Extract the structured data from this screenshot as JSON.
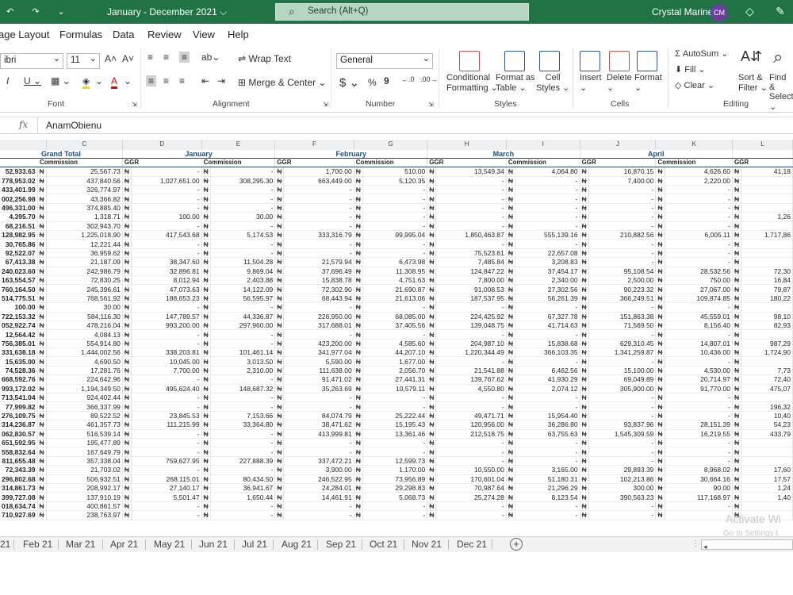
{
  "titlebar": {
    "title": "January - December 2021 ⌵",
    "search": "Search (Alt+Q)",
    "user": "Crystal Marine",
    "initials": "CM"
  },
  "tabs": [
    "age Layout",
    "Formulas",
    "Data",
    "Review",
    "View",
    "Help"
  ],
  "ribbon": {
    "font_name": "ibri",
    "font_size": "11",
    "number_format": "General",
    "wrap_text": "Wrap Text",
    "merge_center": "Merge & Center",
    "cond_format": "Conditional",
    "cond_format2": "Formatting ⌄",
    "format_table": "Format as",
    "format_table2": "Table ⌄",
    "cell_styles": "Cell",
    "cell_styles2": "Styles ⌄",
    "insert": "Insert",
    "delete": "Delete",
    "format": "Format",
    "autosum": "AutoSum ⌄",
    "fill": "Fill ⌄",
    "clear": "Clear ⌄",
    "sort_filter": "Sort &",
    "sort_filter2": "Filter ⌄",
    "find_select": "Find &",
    "find_select2": "Select ⌄",
    "groups": {
      "font": "Font",
      "alignment": "Alignment",
      "number": "Number",
      "styles": "Styles",
      "cells": "Cells",
      "editing": "Editing"
    }
  },
  "formula_bar": {
    "fx": "fx",
    "value": "AnamObienu"
  },
  "sheet": {
    "col_letters": [
      "",
      "C",
      "D",
      "E",
      "F",
      "G",
      "H",
      "I",
      "J",
      "K",
      "L"
    ],
    "header1": {
      "grand_total": "Grand Total",
      "january": "January",
      "february": "February",
      "march": "March",
      "april": "April"
    },
    "header2": {
      "commission": "Commission",
      "ggr": "GGR"
    },
    "currency": "₦",
    "rows": [
      [
        "52,933.63",
        "25,567.73",
        "-",
        "-",
        "1,700.00",
        "510.00",
        "13,549.34",
        "4,064.80",
        "16,870.15",
        "4,626.60",
        "41,18"
      ],
      [
        "778,953.02",
        "437,840.56",
        "1,027,651.00",
        "308,295.30",
        "663,449.00",
        "5,120.35",
        "-",
        "-",
        "7,400.00",
        "2,220.00",
        ""
      ],
      [
        "433,401.99",
        "326,774.97",
        "-",
        "-",
        "-",
        "-",
        "-",
        "-",
        "-",
        "-",
        ""
      ],
      [
        "002,256.98",
        "43,366.82",
        "-",
        "-",
        "-",
        "-",
        "-",
        "-",
        "-",
        "-",
        ""
      ],
      [
        "496,331.00",
        "374,885.40",
        "-",
        "-",
        "-",
        "-",
        "-",
        "-",
        "-",
        "-",
        ""
      ],
      [
        "4,395.70",
        "1,318.71",
        "100.00",
        "30.00",
        "-",
        "-",
        "-",
        "-",
        "-",
        "-",
        "1,26"
      ],
      [
        "68,216.51",
        "302,943.70",
        "-",
        "-",
        "-",
        "-",
        "-",
        "-",
        "-",
        "-",
        ""
      ],
      [
        "128,982.95",
        "1,225,018.90",
        "417,543.68",
        "5,174.53",
        "333,316.79",
        "99,995.04",
        "1,850,463.87",
        "555,139.16",
        "210,882.56",
        "6,005.11",
        "1,717,86"
      ],
      [
        "30,765.86",
        "12,221.44",
        "-",
        "-",
        "-",
        "-",
        "-",
        "-",
        "-",
        "-",
        ""
      ],
      [
        "92,522.07",
        "36,959.62",
        "-",
        "-",
        "-",
        "-",
        "75,523.61",
        "22,657.08",
        "-",
        "-",
        ""
      ],
      [
        "67,413.38",
        "21,187.09",
        "38,347.60",
        "11,504.28",
        "21,579.94",
        "6,473.98",
        "7,485.84",
        "3,208.83",
        "-",
        "-",
        ""
      ],
      [
        "240,023.60",
        "242,986.79",
        "32,896.81",
        "9,869.04",
        "37,696.49",
        "11,308.95",
        "124,847.22",
        "37,454.17",
        "95,108.54",
        "28,532.56",
        "72,30"
      ],
      [
        "163,554.57",
        "72,830.25",
        "8,012.94",
        "2,403.88",
        "15,838.78",
        "4,751.63",
        "7,800.00",
        "2,340.00",
        "2,500.00",
        "750.00",
        "16,84"
      ],
      [
        "760,164.50",
        "245,396.61",
        "47,073.63",
        "14,122.09",
        "72,302.90",
        "21,690.87",
        "91,008.53",
        "27,302.56",
        "90,223.32",
        "27,067.00",
        "79,87"
      ],
      [
        "514,775.51",
        "768,561.92",
        "188,653.23",
        "56,595.97",
        "68,443.94",
        "21,613.06",
        "187,537.95",
        "56,261.39",
        "366,249.51",
        "109,874.85",
        "180,22"
      ],
      [
        "100.00",
        "30.00",
        "-",
        "-",
        "-",
        "-",
        "-",
        "-",
        "-",
        "-",
        ""
      ],
      [
        "722,153.32",
        "584,116.30",
        "147,789.57",
        "44,336.87",
        "226,950.00",
        "68,085.00",
        "224,425.92",
        "67,327.78",
        "151,863.38",
        "45,559.01",
        "98,10"
      ],
      [
        "052,922.74",
        "478,216.04",
        "993,200.00",
        "297,960.00",
        "317,688.01",
        "37,405.56",
        "139,048.75",
        "41,714.63",
        "71,569.50",
        "8,156.40",
        "82,93"
      ],
      [
        "12,564.42",
        "4,084.13",
        "-",
        "-",
        "-",
        "-",
        "-",
        "-",
        "-",
        "-",
        ""
      ],
      [
        "756,385.01",
        "554,914.80",
        "-",
        "-",
        "423,200.00",
        "4,585.60",
        "204,987.10",
        "15,838.68",
        "629,310.45",
        "14,807.01",
        "987,29"
      ],
      [
        "331,638.18",
        "1,444,002.56",
        "338,203.81",
        "101,461.14",
        "341,977.04",
        "44,207.10",
        "1,220,344.49",
        "366,103.35",
        "1,341,259.87",
        "10,436.00",
        "1,724,90"
      ],
      [
        "15,635.00",
        "4,690.50",
        "10,045.00",
        "3,013.50",
        "5,590.00",
        "1,677.00",
        "-",
        "-",
        "-",
        "-",
        ""
      ],
      [
        "74,528.36",
        "17,281.76",
        "7,700.00",
        "2,310.00",
        "111,638.00",
        "2,056.70",
        "21,541.88",
        "6,462.56",
        "15,100.00",
        "4,530.00",
        "7,73"
      ],
      [
        "668,592.76",
        "224,642.96",
        "-",
        "-",
        "91,471.02",
        "27,441.31",
        "139,767.62",
        "41,930.29",
        "69,049.89",
        "20,714.97",
        "72,40"
      ],
      [
        "993,172.02",
        "1,194,349.50",
        "495,624.40",
        "148,687.32",
        "35,263.69",
        "10,579.11",
        "4,550.80",
        "2,074.12",
        "305,900.00",
        "91,770.00",
        "475,07"
      ],
      [
        "713,541.04",
        "924,402.44",
        "-",
        "-",
        "-",
        "-",
        "-",
        "-",
        "-",
        "-",
        ""
      ],
      [
        "77,999.82",
        "366,337.99",
        "-",
        "-",
        "-",
        "-",
        "-",
        "-",
        "-",
        "-",
        "196,32"
      ],
      [
        "276,109.75",
        "89,522.52",
        "23,845.53",
        "7,153.66",
        "84,074.79",
        "25,222.44",
        "49,471.71",
        "15,954.40",
        "-",
        "-",
        "10,40"
      ],
      [
        "314,236.87",
        "461,357.73",
        "111,215.99",
        "33,364.80",
        "38,471.62",
        "15,195.43",
        "120,956.00",
        "36,286.80",
        "93,837.96",
        "28,151.39",
        "54,23"
      ],
      [
        "062,830.57",
        "516,539.14",
        "-",
        "-",
        "413,999.81",
        "13,361.46",
        "212,518.75",
        "63,755.63",
        "1,545,309.59",
        "16,219.55",
        "433,79"
      ],
      [
        "651,592.95",
        "195,477.89",
        "-",
        "-",
        "-",
        "-",
        "-",
        "-",
        "-",
        "-",
        ""
      ],
      [
        "558,832.64",
        "167,649.79",
        "-",
        "-",
        "-",
        "-",
        "-",
        "-",
        "-",
        "-",
        ""
      ],
      [
        "811,655.48",
        "357,338.04",
        "759,627.95",
        "227,888.39",
        "337,472.21",
        "12,599.73",
        "-",
        "-",
        "-",
        "-",
        ""
      ],
      [
        "72,343.39",
        "21,703.02",
        "-",
        "-",
        "3,900.00",
        "1,170.00",
        "10,550.00",
        "3,165.00",
        "29,893.39",
        "8,968.02",
        "17,60"
      ],
      [
        "296,802.68",
        "506,932.51",
        "268,115.01",
        "80,434.50",
        "246,522.95",
        "73,956.89",
        "170,601.04",
        "51,180.31",
        "102,213.86",
        "30,664.16",
        "17,57"
      ],
      [
        "314,861.73",
        "208,992.17",
        "27,140.17",
        "36,941.67",
        "24,284.01",
        "29,298.83",
        "70,987.64",
        "21,296.29",
        "300.00",
        "90.00",
        "1,24"
      ],
      [
        "399,727.08",
        "137,910.19",
        "5,501.47",
        "1,650.44",
        "14,461.91",
        "5,068.73",
        "25,274.28",
        "8,123.54",
        "390,563.23",
        "117,168.97",
        "1,40"
      ],
      [
        "018,634.74",
        "400,861.57",
        "-",
        "-",
        "-",
        "-",
        "-",
        "-",
        "-",
        "-",
        ""
      ],
      [
        "710,927.69",
        "238,763.97",
        "-",
        "-",
        "-",
        "-",
        "-",
        "-",
        "-",
        "-",
        ""
      ]
    ]
  },
  "sheet_tabs": [
    "21",
    "Feb 21",
    "Mar 21",
    "Apr 21",
    "May 21",
    "Jun 21",
    "Jul 21",
    "Aug 21",
    "Sep 21",
    "Oct 21",
    "Nov 21",
    "Dec 21"
  ],
  "watermark": {
    "line1": "Activate Wi",
    "line2": "Go to Settings t"
  }
}
